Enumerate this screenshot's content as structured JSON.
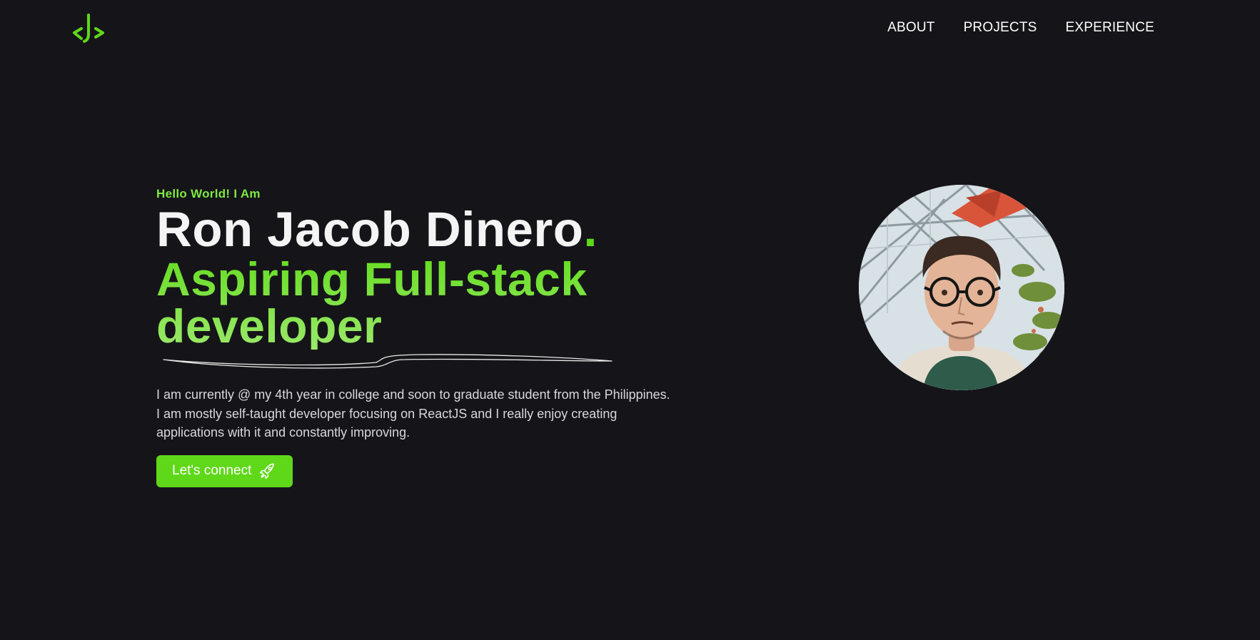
{
  "colors": {
    "background": "#151519",
    "accent": "#5fd81a",
    "accent_light": "#9be86a",
    "text": "#f4f4f4"
  },
  "header": {
    "logo_icon": "code-chevron-logo",
    "nav": [
      {
        "label": "ABOUT"
      },
      {
        "label": "PROJECTS"
      },
      {
        "label": "EXPERIENCE"
      }
    ]
  },
  "hero": {
    "greeting": "Hello World! I Am",
    "name": "Ron Jacob Dinero",
    "name_suffix": ".",
    "role_line1": "Aspiring Full-stack",
    "role_line2": "developer",
    "bio": "I am currently @ my 4th year in college and soon to graduate student from the Philippines. I am mostly self-taught developer focusing on ReactJS and I really enjoy creating applications with it and constantly improving.",
    "cta_label": "Let's connect",
    "cta_icon": "rocket-icon"
  },
  "profile": {
    "photo": "profile-photo"
  }
}
